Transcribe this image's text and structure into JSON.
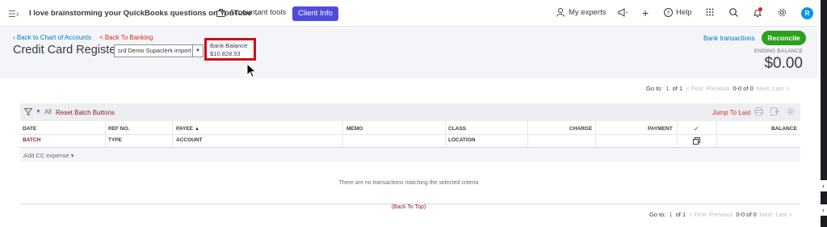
{
  "topbar": {
    "company_name": "I love brainstorming your QuickBooks questions on YouTube",
    "company_chevron": "⌄",
    "accountant_tools": "Accountant tools",
    "client_info": "Client Info",
    "my_experts": "My experts",
    "help": "Help",
    "avatar_initial": "R"
  },
  "breadcrumbs": {
    "back_to_chart": "Back to Chart of Accounts",
    "back_to_banking": "< Back To Banking"
  },
  "page": {
    "title": "Credit Card Register",
    "account_selected": "srd Demo Supaclerk import"
  },
  "bank_balance": {
    "label": "Bank Balance",
    "value": "$10,828.53"
  },
  "actions": {
    "bank_transactions": "Bank transactions",
    "reconcile": "Reconcile"
  },
  "ending_balance": {
    "label": "ENDING BALANCE",
    "value": "$0.00"
  },
  "pager": {
    "goto": "Go to:",
    "page": "1",
    "of": "of 1",
    "first": "< First",
    "previous": "Previous",
    "range": "0-0 of 0",
    "next": "Next",
    "last": "Last >"
  },
  "toolbar": {
    "filter_all": "All",
    "reset_batch": "Reset Batch Buttons",
    "jump_to_last": "Jump To Last"
  },
  "columns": {
    "row1": {
      "date": "DATE",
      "ref": "REF NO.",
      "payee": "PAYEE ▲",
      "memo": "MEMO",
      "class": "CLASS",
      "charge": "CHARGE",
      "payment": "PAYMENT",
      "check": "✓",
      "balance": "BALANCE"
    },
    "row2": {
      "batch": "BATCH",
      "type": "TYPE",
      "account": "ACCOUNT",
      "location": "LOCATION"
    }
  },
  "add_row": {
    "label": "Add CC expense ▾"
  },
  "empty_message": "There are no transactions matching the selected criteria",
  "back_to_top": "(Back To Top)",
  "colors": {
    "client_button": "#4f4bdb",
    "reconcile_button": "#2ca01c",
    "link_blue": "#0077c5",
    "highlight_red": "#c8101e"
  }
}
